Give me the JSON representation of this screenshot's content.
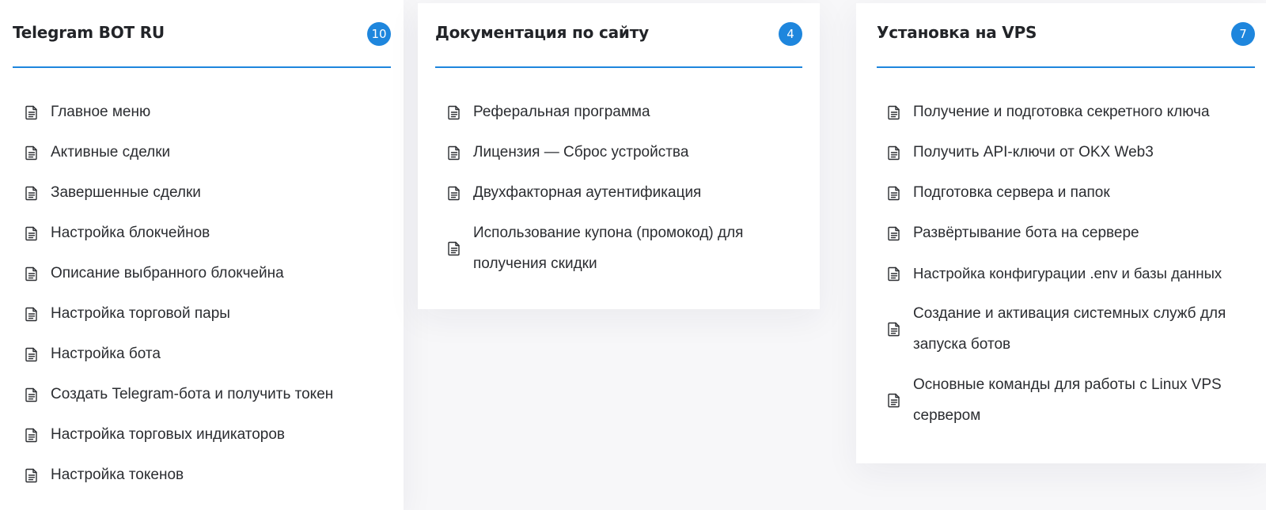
{
  "cards": [
    {
      "title": "Telegram BOT RU",
      "count": "10",
      "items": [
        "Главное меню",
        "Активные сделки",
        "Завершенные сделки",
        "Настройка блокчейнов",
        "Описание выбранного блокчейна",
        "Настройка торговой пары",
        "Настройка бота",
        "Создать Telegram-бота и получить токен",
        "Настройка торговых индикаторов",
        "Настройка токенов"
      ]
    },
    {
      "title": "Документация по сайту",
      "count": "4",
      "items": [
        "Реферальная программа",
        "Лицензия — Сброс устройства",
        "Двухфакторная аутентификация",
        "Использование купона (промокод) для получения скидки"
      ]
    },
    {
      "title": "Установка на VPS",
      "count": "7",
      "items": [
        "Получение и подготовка секретного ключа",
        "Получить API-ключи от OKX Web3",
        "Подготовка сервера и папок",
        "Развёртывание бота на сервере",
        "Настройка конфигурации .env и базы данных",
        "Создание и активация системных служб для запуска ботов",
        "Основные команды для работы с Linux VPS сервером"
      ]
    }
  ],
  "icons": {
    "item_icon": "document-icon"
  },
  "colors": {
    "accent": "#1e86dd",
    "title_text": "#222428",
    "item_text": "#2b2d31",
    "card_bg": "#ffffff",
    "page_bg": "#f7f7f9"
  }
}
